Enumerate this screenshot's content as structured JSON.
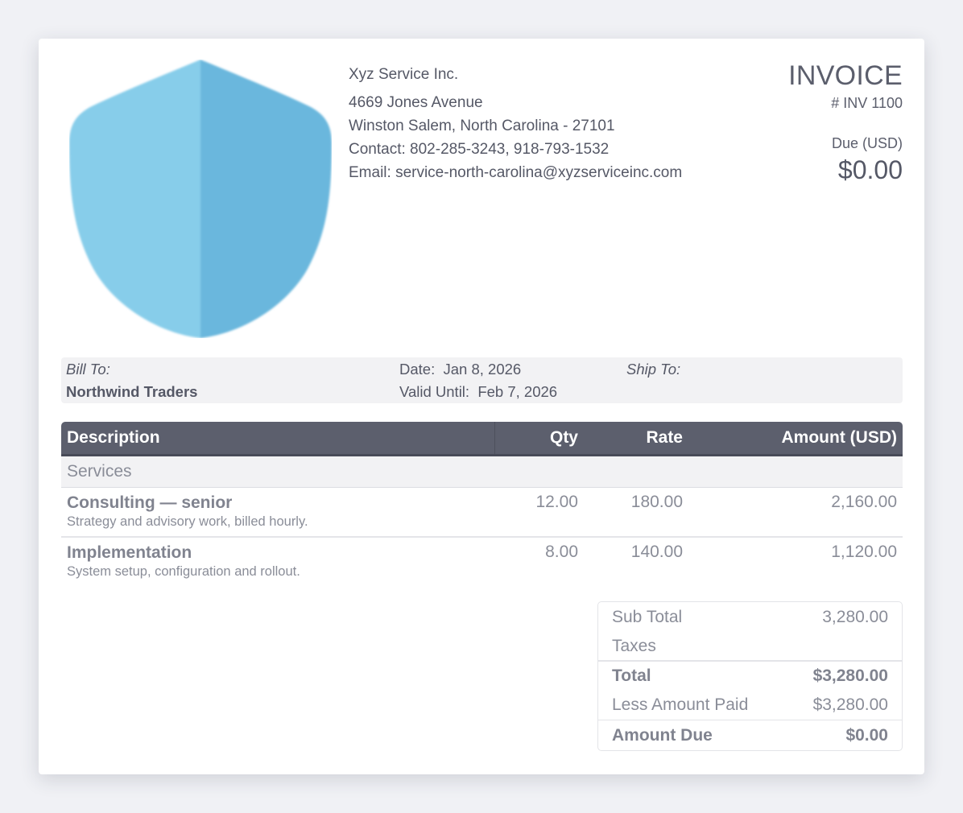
{
  "company": {
    "name": "Xyz Service Inc.",
    "address_line1": "4669 Jones Avenue",
    "address_line2": "Winston Salem, North Carolina - 27101",
    "contact": "Contact: 802-285-3243, 918-793-1532",
    "email": "Email: service-north-carolina@xyzserviceinc.com"
  },
  "logo": {
    "icon": "shield-icon",
    "color_light": "#87cdea",
    "color_dark": "#6ab7dd"
  },
  "invoice": {
    "title": "INVOICE",
    "number": "# INV 1100",
    "due_label": "Due (USD)",
    "due_amount": "$0.00"
  },
  "billing": {
    "bill_to_label": "Bill To:",
    "bill_to_name": "Northwind Traders",
    "date_label": "Date:",
    "date_value": "Jan 8, 2026",
    "valid_label": "Valid Until:",
    "valid_value": "Feb 7, 2026",
    "ship_to_label": "Ship To:"
  },
  "table": {
    "headers": {
      "description": "Description",
      "qty": "Qty",
      "rate": "Rate",
      "amount": "Amount (USD)"
    },
    "group": "Services",
    "items": [
      {
        "title": "Consulting — senior",
        "desc": "Strategy and advisory work, billed hourly.",
        "qty": "12.00",
        "rate": "180.00",
        "amount": "2,160.00"
      },
      {
        "title": "Implementation",
        "desc": "System setup, configuration and rollout.",
        "qty": "8.00",
        "rate": "140.00",
        "amount": "1,120.00"
      }
    ]
  },
  "totals": {
    "subtotal_label": "Sub Total",
    "subtotal_value": "3,280.00",
    "taxes_label": "Taxes",
    "total_label": "Total",
    "total_value": "$3,280.00",
    "paid_label": "Less Amount Paid",
    "paid_value": "$3,280.00",
    "due_label": "Amount Due",
    "due_value": "$0.00"
  },
  "colors": {
    "header_bg": "#5c5f6d",
    "text": "#555866",
    "muted": "#8a8d98",
    "band": "#f2f2f4",
    "background": "#f0f1f5"
  }
}
